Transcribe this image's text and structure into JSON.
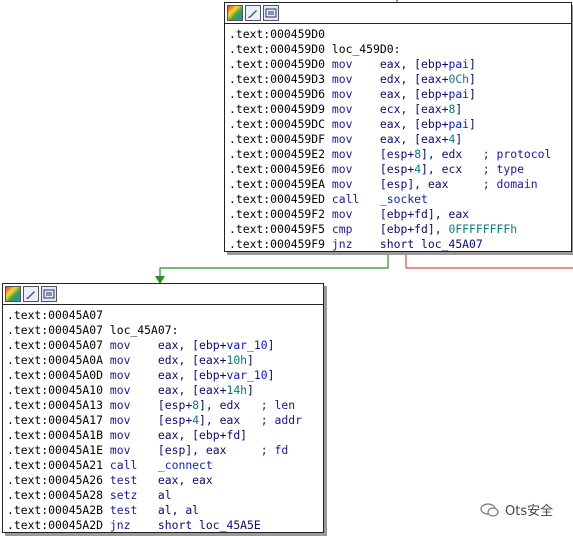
{
  "colors": {
    "edge_true": "#2e8b2e",
    "edge_false": "#d94a4a",
    "edge_top": "#333333"
  },
  "toolbar_icons": [
    "color-palette-icon",
    "pen-edit-icon",
    "graph-view-icon"
  ],
  "block1": {
    "lines": [
      {
        "addr": ".text:000459D0",
        "text": ""
      },
      {
        "addr": ".text:000459D0",
        "label": "loc_459D0:"
      },
      {
        "addr": ".text:000459D0",
        "mn": "mov",
        "op": "eax, [ebp+",
        "var": "pai",
        "op2": "]"
      },
      {
        "addr": ".text:000459D3",
        "mn": "mov",
        "op": "edx, [eax+",
        "num": "0Ch",
        "op2": "]"
      },
      {
        "addr": ".text:000459D6",
        "mn": "mov",
        "op": "eax, [ebp+",
        "var": "pai",
        "op2": "]"
      },
      {
        "addr": ".text:000459D9",
        "mn": "mov",
        "op": "ecx, [eax+",
        "num": "8",
        "op2": "]"
      },
      {
        "addr": ".text:000459DC",
        "mn": "mov",
        "op": "eax, [ebp+",
        "var": "pai",
        "op2": "]"
      },
      {
        "addr": ".text:000459DF",
        "mn": "mov",
        "op": "eax, [eax+",
        "num": "4",
        "op2": "]"
      },
      {
        "addr": ".text:000459E2",
        "mn": "mov",
        "op": "[esp+",
        "num": "8",
        "op2": "], edx",
        "cmt": "; protocol"
      },
      {
        "addr": ".text:000459E6",
        "mn": "mov",
        "op": "[esp+",
        "num": "4",
        "op2": "], ecx",
        "cmt": "; type"
      },
      {
        "addr": ".text:000459EA",
        "mn": "mov",
        "op": "[esp], eax",
        "cmt": "; domain"
      },
      {
        "addr": ".text:000459ED",
        "mn": "call",
        "call": "_socket"
      },
      {
        "addr": ".text:000459F2",
        "mn": "mov",
        "op": "[ebp+fd], eax"
      },
      {
        "addr": ".text:000459F5",
        "mn": "cmp",
        "op": "[ebp+fd], ",
        "num": "0FFFFFFFFh"
      },
      {
        "addr": ".text:000459F9",
        "mn": "jnz",
        "op": "short loc_45A07"
      }
    ]
  },
  "block2": {
    "lines": [
      {
        "addr": ".text:00045A07",
        "text": ""
      },
      {
        "addr": ".text:00045A07",
        "label": "loc_45A07:"
      },
      {
        "addr": ".text:00045A07",
        "mn": "mov",
        "op": "eax, [ebp+",
        "var": "var_10",
        "op2": "]"
      },
      {
        "addr": ".text:00045A0A",
        "mn": "mov",
        "op": "edx, [eax+",
        "num": "10h",
        "op2": "]"
      },
      {
        "addr": ".text:00045A0D",
        "mn": "mov",
        "op": "eax, [ebp+",
        "var": "var_10",
        "op2": "]"
      },
      {
        "addr": ".text:00045A10",
        "mn": "mov",
        "op": "eax, [eax+",
        "num": "14h",
        "op2": "]"
      },
      {
        "addr": ".text:00045A13",
        "mn": "mov",
        "op": "[esp+",
        "num": "8",
        "op2": "], edx",
        "cmt": "; len"
      },
      {
        "addr": ".text:00045A17",
        "mn": "mov",
        "op": "[esp+",
        "num": "4",
        "op2": "], eax",
        "cmt": "; addr"
      },
      {
        "addr": ".text:00045A1B",
        "mn": "mov",
        "op": "eax, [ebp+fd]"
      },
      {
        "addr": ".text:00045A1E",
        "mn": "mov",
        "op": "[esp], eax",
        "cmt": "; fd"
      },
      {
        "addr": ".text:00045A21",
        "mn": "call",
        "call": "_connect"
      },
      {
        "addr": ".text:00045A26",
        "mn": "test",
        "op": "eax, eax"
      },
      {
        "addr": ".text:00045A28",
        "mn": "setz",
        "op": "al"
      },
      {
        "addr": ".text:00045A2B",
        "mn": "test",
        "op": "al, al"
      },
      {
        "addr": ".text:00045A2D",
        "mn": "jnz",
        "op": "short loc_45A5E"
      }
    ]
  },
  "watermark": {
    "text": "Ots安全"
  }
}
